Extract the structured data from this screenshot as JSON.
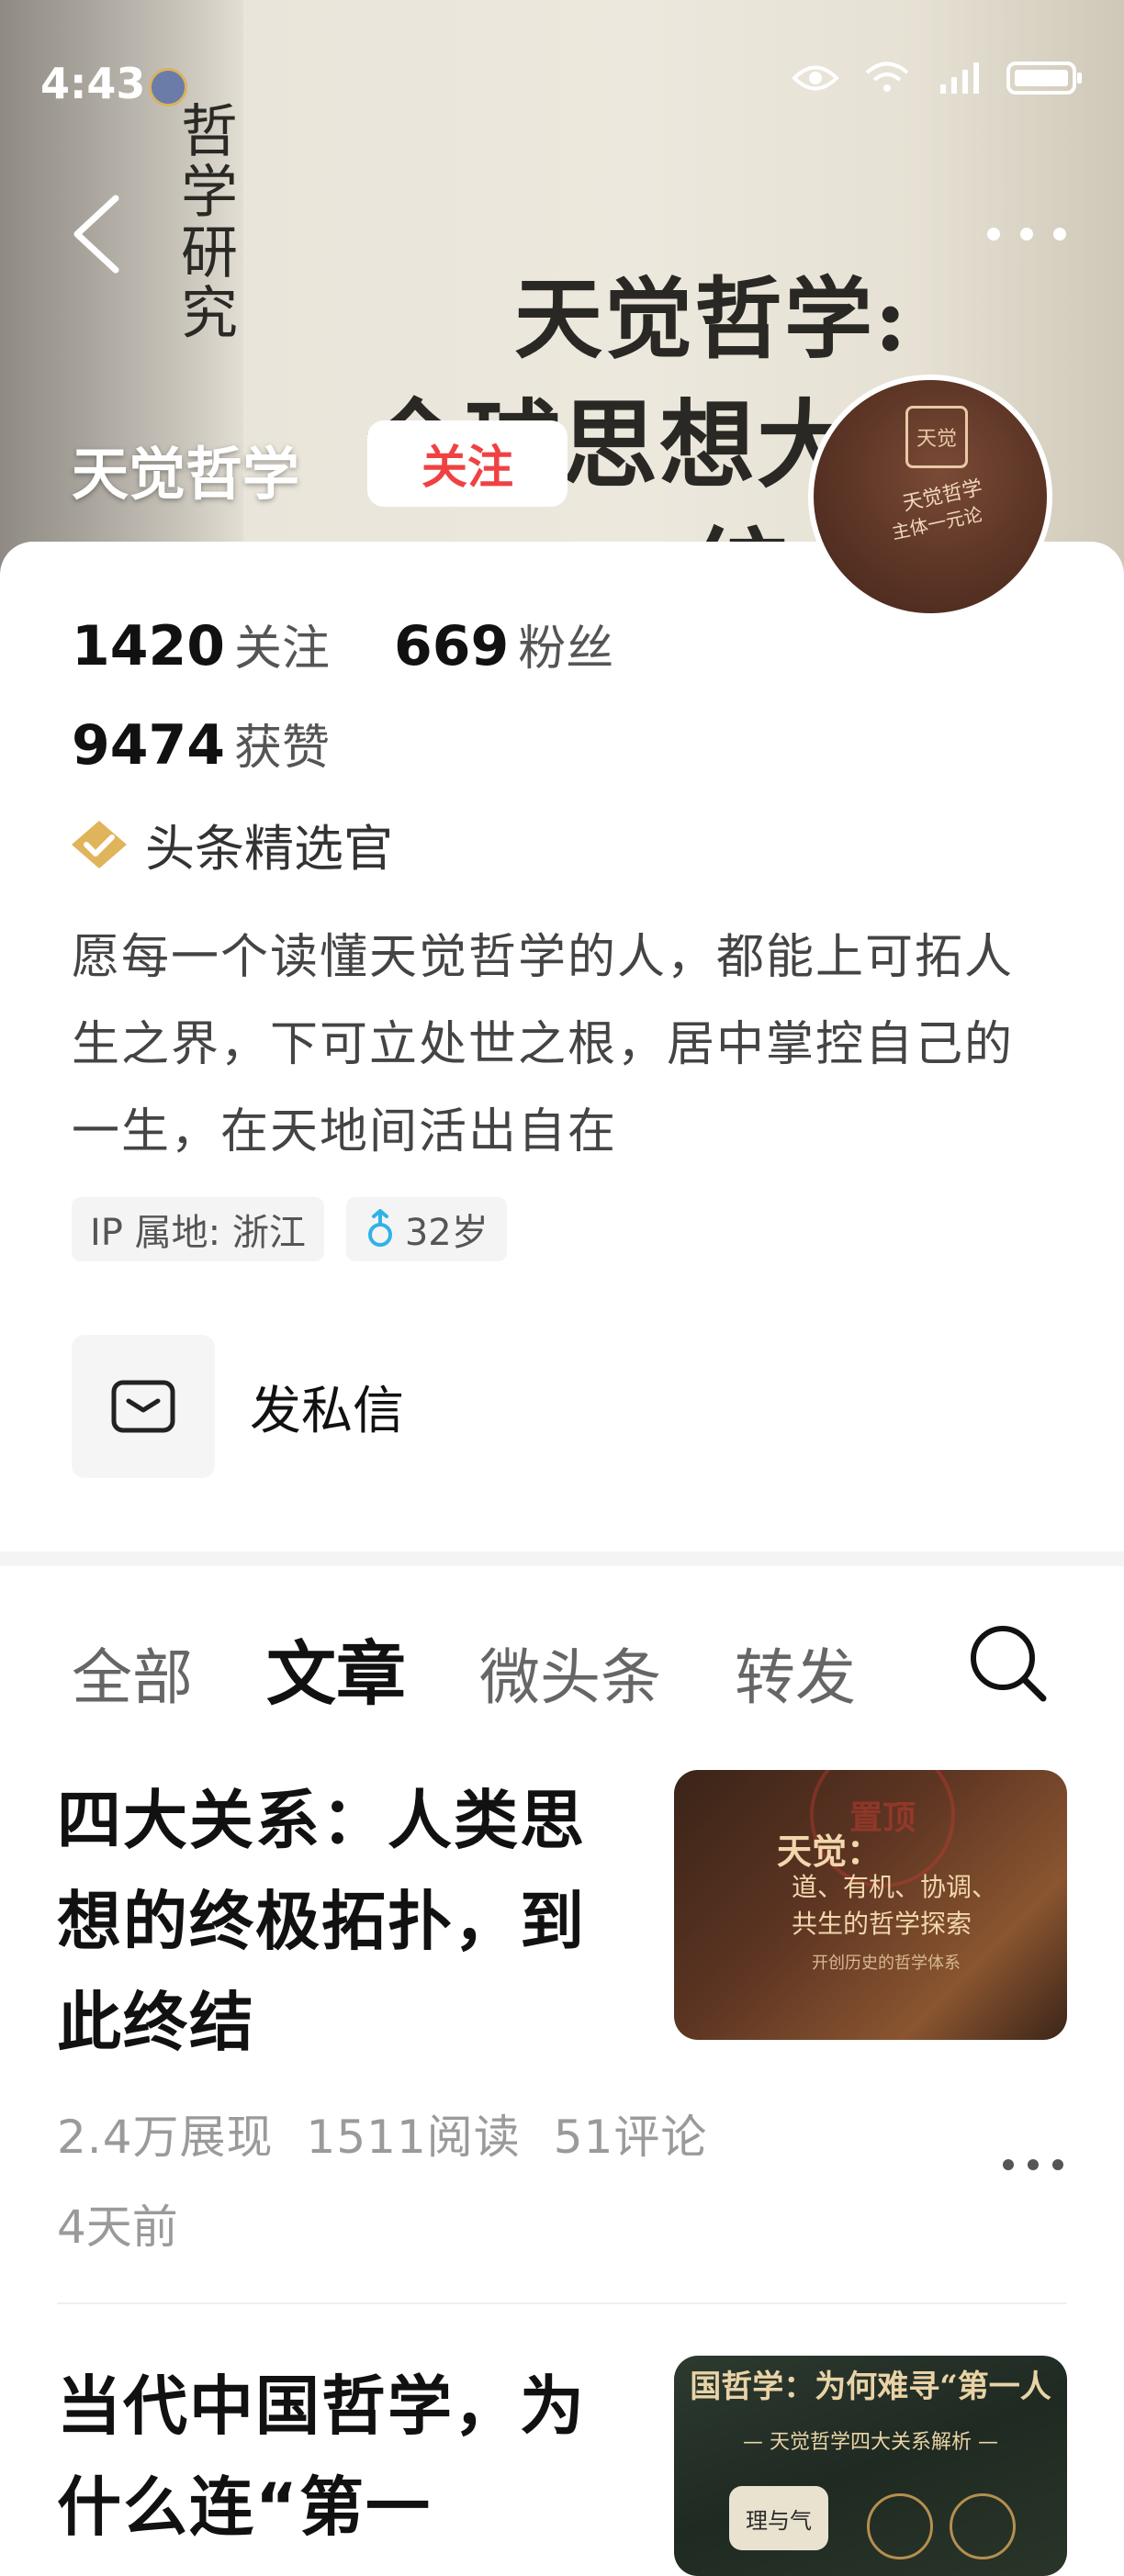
{
  "status_bar": {
    "time": "4:43"
  },
  "banner": {
    "spine_text": "哲学研究",
    "cover_title": "天觉哲学:",
    "cover_line2": "全球思想大一",
    "cover_line3": "一统"
  },
  "profile": {
    "name": "天觉哲学",
    "follow_label": "关注",
    "avatar_seal": "天觉",
    "avatar_text1": "天觉哲学",
    "avatar_text2": "主体一元论",
    "following_count": "1420",
    "following_label": "关注",
    "followers_count": "669",
    "followers_label": "粉丝",
    "likes_count": "9474",
    "likes_label": "获赞",
    "badge": "头条精选官",
    "bio": "愿每一个读懂天觉哲学的人，都能上可拓人生之界，下可立处世之根，居中掌控自己的一生，在天地间活出自在",
    "ip": "IP 属地: 浙江",
    "age": "32岁",
    "message_label": "发私信"
  },
  "tabs": [
    "全部",
    "文章",
    "微头条",
    "转发"
  ],
  "active_tab": "文章",
  "articles": [
    {
      "title": "四大关系：人类思想的终极拓扑，到此终结",
      "thumb_stamp": "置顶",
      "thumb_title": "天觉：",
      "thumb_subtitle": "道、有机、协调、共生的哲学探索",
      "thumb_caption": "开创历史的哲学体系",
      "impressions": "2.4万展现",
      "reads": "1511阅读",
      "comments": "51评论",
      "time": "4天前"
    },
    {
      "title": "当代中国哲学，为什么连“第一",
      "thumb_title": "国哲学：为何难寻“第一人",
      "thumb_subtitle": "— 天觉哲学四大关系解析 —",
      "thumb_chip": "理与气"
    }
  ],
  "colors": {
    "accent": "#f04142",
    "badge_gold": "#e0b45a",
    "age_icon": "#2fb3e8"
  }
}
